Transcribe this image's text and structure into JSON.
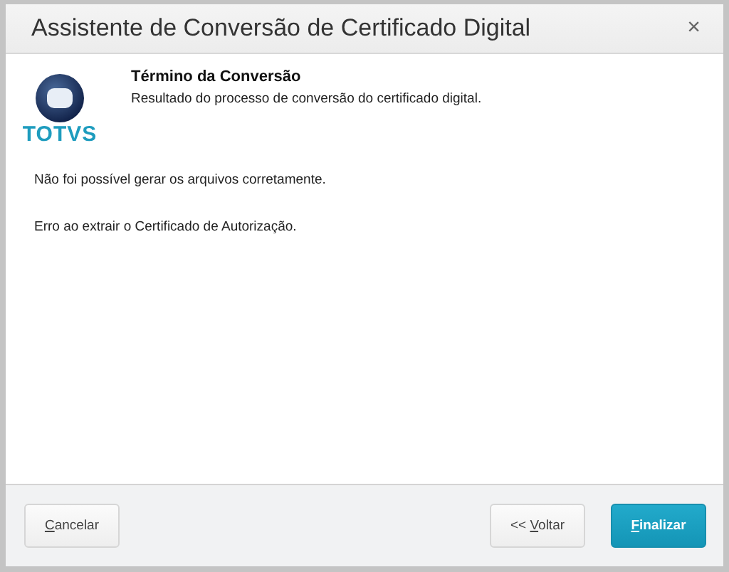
{
  "window": {
    "title": "Assistente de Conversão de Certificado Digital",
    "close": "×"
  },
  "logo": {
    "text": "TOTVS"
  },
  "step": {
    "title": "Término da Conversão",
    "subtitle": "Resultado do processo de conversão do certificado digital."
  },
  "messages": [
    "Não foi possível gerar os arquivos corretamente.",
    "Erro ao extrair o Certificado de Autorização."
  ],
  "buttons": [
    {
      "kind": "default",
      "key": "C",
      "rest": "ancelar"
    },
    {
      "kind": "default",
      "prefix": "<< ",
      "key": "V",
      "rest": "oltar"
    },
    {
      "kind": "primary",
      "key": "F",
      "rest": "inalizar"
    }
  ]
}
